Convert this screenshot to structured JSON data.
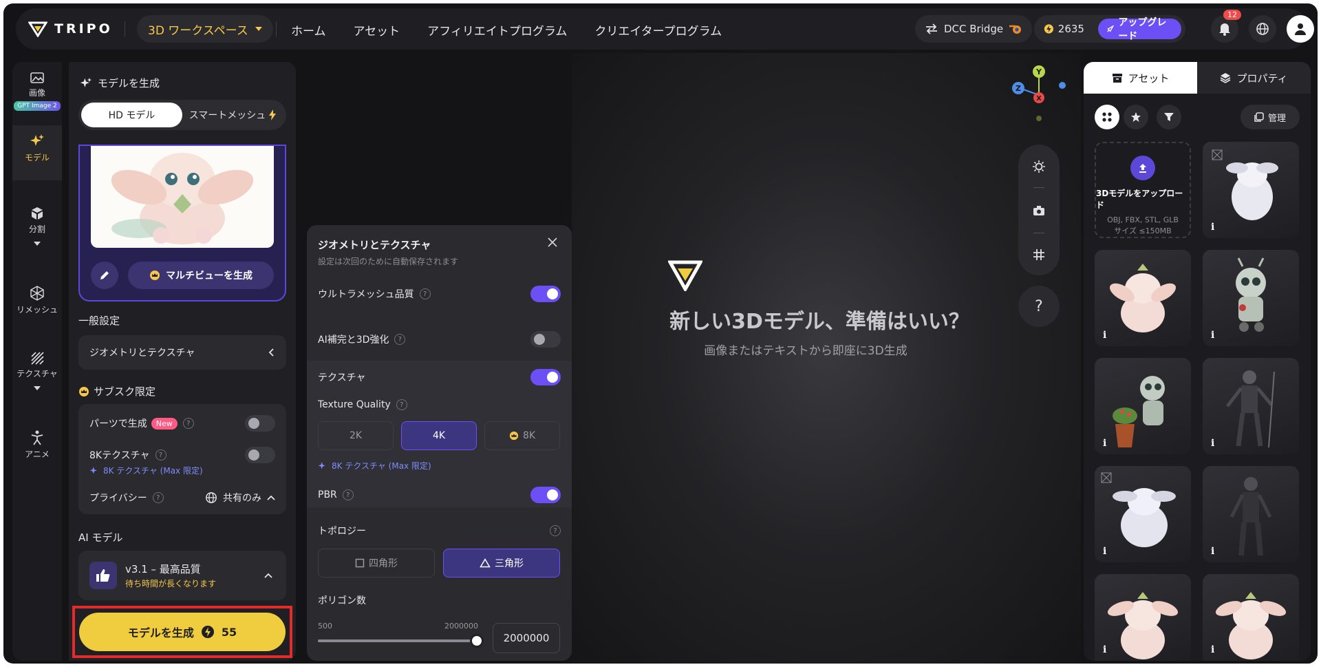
{
  "topbar": {
    "brand": "TRIPO",
    "workspace": "3D ワークスペース",
    "nav": [
      "ホーム",
      "アセット",
      "アフィリエイトプログラム",
      "クリエイタープログラム"
    ],
    "dcc_bridge": "DCC Bridge",
    "credits": "2635",
    "upgrade": "アップグレード",
    "notification_count": "12"
  },
  "rail": {
    "items": [
      {
        "label": "画像",
        "tag": "GPT Image 2",
        "icon": "image-icon"
      },
      {
        "label": "モデル",
        "icon": "sparkle-icon"
      },
      {
        "label": "分割",
        "icon": "cube-icon"
      },
      {
        "label": "リメッシュ",
        "icon": "mesh-icon"
      },
      {
        "label": "テクスチャ",
        "icon": "texture-icon"
      },
      {
        "label": "アニメ",
        "icon": "figure-icon"
      }
    ]
  },
  "panel": {
    "title": "モデルを生成",
    "modes": [
      "HD モデル",
      "スマートメッシュ"
    ],
    "multiview": "マルチビューを生成",
    "general_settings": "一般設定",
    "geometry_texture": "ジオメトリとテクスチャ",
    "subscription_only": "サブスク限定",
    "generate_parts": "パーツで生成",
    "new_tag": "New",
    "texture_8k": "8Kテクスチャ",
    "texture_8k_note": "8K テクスチャ (Max 限定)",
    "privacy": "プライバシー",
    "privacy_value": "共有のみ",
    "ai_model": "AI モデル",
    "model_name": "v3.1 – 最高品質",
    "model_note": "待ち時間が長くなります",
    "generate_button": "モデルを生成",
    "generate_cost": "55"
  },
  "modal": {
    "title": "ジオメトリとテクスチャ",
    "subtitle": "設定は次回のために自動保存されます",
    "ultra_mesh": "ウルトラメッシュ品質",
    "ai_complete": "AI補完と3D強化",
    "texture": "テクスチャ",
    "texture_quality": "Texture Quality",
    "quality_options": [
      "2K",
      "4K",
      "8K"
    ],
    "texture_note": "8K テクスチャ (Max 限定)",
    "pbr": "PBR",
    "topology": "トポロジー",
    "topology_options": [
      "四角形",
      "三角形"
    ],
    "polygon_count": "ポリゴン数",
    "slider_min": "500",
    "slider_max": "2000000",
    "polygon_value": "2000000"
  },
  "viewport": {
    "heading": "新しい3Dモデル、準備はいい？",
    "sub": "画像またはテキストから即座に3D生成",
    "help": "?"
  },
  "rpanel": {
    "tabs": [
      "アセット",
      "プロパティ"
    ],
    "manage": "管理",
    "upload_title": "3Dモデルをアップロード",
    "upload_formats": "OBJ, FBX, STL, GLB",
    "upload_size": "サイズ ≤150MB",
    "info": "i"
  },
  "colors": {
    "accent": "#6c4ff5",
    "brand_yellow": "#f0cd3f",
    "highlight": "#e52a2a"
  }
}
